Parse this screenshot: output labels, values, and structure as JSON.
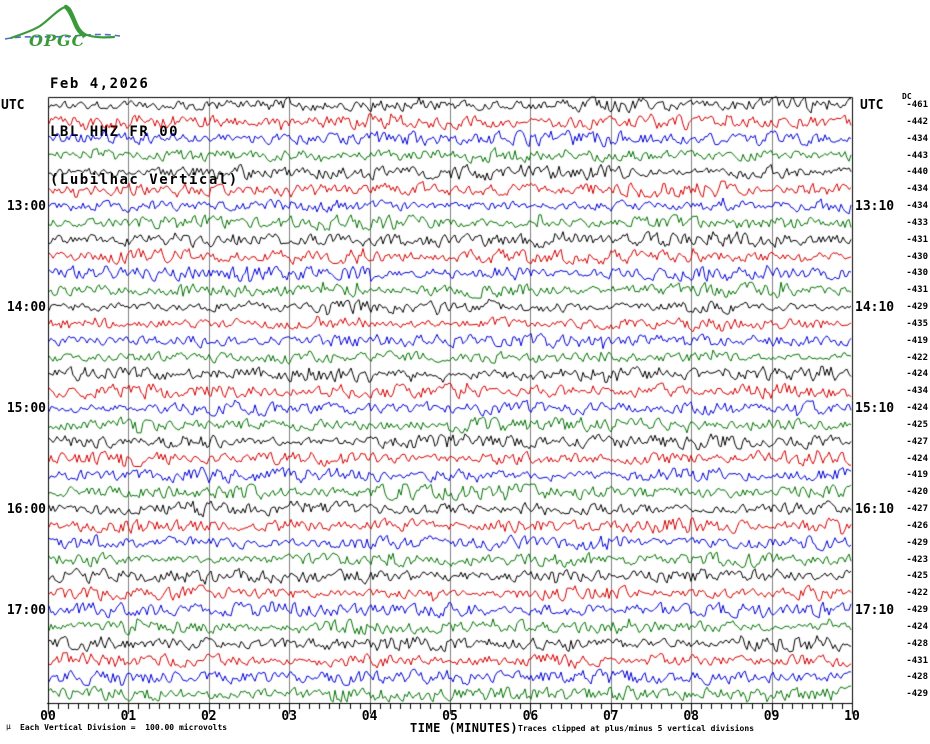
{
  "header": {
    "logo_text": "OPGC",
    "date": "Feb 4,2026",
    "station": "LBL HHZ FR 00",
    "station_name": "(Lubilhac Vertical)"
  },
  "axes": {
    "left_utc": "UTC",
    "right_utc": "UTC",
    "dc_header": "DC",
    "x_label": "TIME (MINUTES)"
  },
  "footer": {
    "micro_mark": "µ",
    "scale_note": "Each Vertical Division =  100.00 microvolts",
    "clip_note": "Traces clipped at plus/minus 5 vertical divisions"
  },
  "chart_data": {
    "type": "line",
    "subtype": "helicorder-seismogram",
    "title": "LBL HHZ FR 00 (Lubilhac Vertical) Feb 4,2026",
    "xlabel": "TIME (MINUTES)",
    "x_range_minutes": [
      0,
      10
    ],
    "x_ticks": [
      "00",
      "01",
      "02",
      "03",
      "04",
      "05",
      "06",
      "07",
      "08",
      "09",
      "10"
    ],
    "minor_subdivisions_per_minute": 8,
    "minutes_per_row": 10,
    "grid": "vertical gray line at each minute",
    "scale_note": "Each Vertical Division = 100.00 microvolts",
    "clip_note": "Traces clipped at plus/minus 5 vertical divisions",
    "trace_colors_cycle": [
      "black",
      "red",
      "blue",
      "green"
    ],
    "color_hex": {
      "black": "#000000",
      "red": "#d40000",
      "blue": "#0000d4",
      "green": "#007400",
      "gridline": "#808080",
      "logo_green": "#3a9a3a",
      "logo_blue": "#4a6fc9"
    },
    "waveform_note": "continuous background microseismic noise, peak-to-peak about one vertical division, no distinct events",
    "rows": [
      {
        "index": 0,
        "color": "black",
        "dc": -461
      },
      {
        "index": 1,
        "color": "red",
        "dc": -442
      },
      {
        "index": 2,
        "color": "blue",
        "dc": -434
      },
      {
        "index": 3,
        "color": "green",
        "dc": -443
      },
      {
        "index": 4,
        "color": "black",
        "dc": -440
      },
      {
        "index": 5,
        "color": "red",
        "dc": -434
      },
      {
        "index": 6,
        "color": "blue",
        "dc": -434,
        "utc_left": "13:00",
        "utc_right": "13:10"
      },
      {
        "index": 7,
        "color": "green",
        "dc": -433
      },
      {
        "index": 8,
        "color": "black",
        "dc": -431
      },
      {
        "index": 9,
        "color": "red",
        "dc": -430
      },
      {
        "index": 10,
        "color": "blue",
        "dc": -430
      },
      {
        "index": 11,
        "color": "green",
        "dc": -431
      },
      {
        "index": 12,
        "color": "black",
        "dc": -429,
        "utc_left": "14:00",
        "utc_right": "14:10"
      },
      {
        "index": 13,
        "color": "red",
        "dc": -435
      },
      {
        "index": 14,
        "color": "blue",
        "dc": -419
      },
      {
        "index": 15,
        "color": "green",
        "dc": -422
      },
      {
        "index": 16,
        "color": "black",
        "dc": -424
      },
      {
        "index": 17,
        "color": "red",
        "dc": -434
      },
      {
        "index": 18,
        "color": "blue",
        "dc": -424,
        "utc_left": "15:00",
        "utc_right": "15:10"
      },
      {
        "index": 19,
        "color": "green",
        "dc": -425
      },
      {
        "index": 20,
        "color": "black",
        "dc": -427
      },
      {
        "index": 21,
        "color": "red",
        "dc": -424
      },
      {
        "index": 22,
        "color": "blue",
        "dc": -419
      },
      {
        "index": 23,
        "color": "green",
        "dc": -420
      },
      {
        "index": 24,
        "color": "black",
        "dc": -427,
        "utc_left": "16:00",
        "utc_right": "16:10"
      },
      {
        "index": 25,
        "color": "red",
        "dc": -426
      },
      {
        "index": 26,
        "color": "blue",
        "dc": -429
      },
      {
        "index": 27,
        "color": "green",
        "dc": -423
      },
      {
        "index": 28,
        "color": "black",
        "dc": -425
      },
      {
        "index": 29,
        "color": "red",
        "dc": -422
      },
      {
        "index": 30,
        "color": "blue",
        "dc": -429,
        "utc_left": "17:00",
        "utc_right": "17:10"
      },
      {
        "index": 31,
        "color": "green",
        "dc": -424
      },
      {
        "index": 32,
        "color": "black",
        "dc": -428
      },
      {
        "index": 33,
        "color": "red",
        "dc": -431
      },
      {
        "index": 34,
        "color": "blue",
        "dc": -428
      },
      {
        "index": 35,
        "color": "green",
        "dc": -429
      }
    ]
  }
}
